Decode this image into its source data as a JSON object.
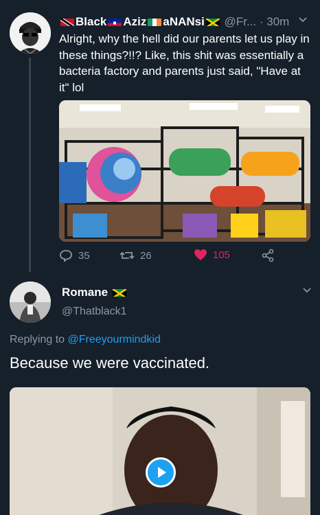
{
  "tweet": {
    "display_name_1": "Black",
    "display_name_2": "Aziz",
    "display_name_3": "aNANsi",
    "handle": "@Fr...",
    "separator": "·",
    "time": "30m",
    "text": "Alright, why the hell did our parents let us play in these things?!!? Like, this shit was essentially a bacteria factory and parents just said, \"Have at it\" lol",
    "replies": "35",
    "retweets": "26",
    "likes": "105",
    "image_icon": "playground-photo",
    "colors": {
      "like": "#e0245e",
      "muted": "#8899a6",
      "background": "#15202b"
    }
  },
  "reply_tweet": {
    "display_name": "Romane",
    "handle": "@Thatblack1",
    "replying_prefix": "Replying to",
    "replying_to": "@Freeyourmindkid",
    "text": "Because we were vaccinated.",
    "media_icon": "gif-play-icon",
    "colors": {
      "link": "#1da1f2"
    }
  }
}
